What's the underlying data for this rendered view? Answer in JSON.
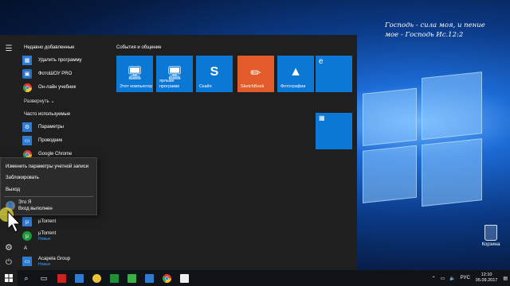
{
  "desktop": {
    "verse_line1": "Господь - сила моя, и пение",
    "verse_line2": "мое - Господь    Ис.12:2",
    "recycle_bin_label": "Корзина"
  },
  "start_menu": {
    "recently_added_header": "Недавно добавленные",
    "recent_apps": [
      {
        "label": "Удалить программу",
        "icon": "uninstall-icon"
      },
      {
        "label": "ФотоШОУ PRO",
        "icon": "photoshow-icon"
      },
      {
        "label": "Он-лайн учебник",
        "icon": "chrome-icon"
      }
    ],
    "expand_label": "Развернуть ⌄",
    "most_used_header": "Часто используемые",
    "most_used_apps": [
      {
        "label": "Параметры",
        "icon": "gear-icon"
      },
      {
        "label": "Проводник",
        "icon": "folder-icon"
      },
      {
        "label": "Google Chrome",
        "icon": "chrome-icon"
      }
    ],
    "bottom_apps": [
      {
        "label": "µTorrent",
        "sub": "",
        "icon": "utorrent-icon"
      },
      {
        "label": "µTorrent",
        "sub": "Новые",
        "icon": "utorrent-icon"
      }
    ],
    "letter_a": "A",
    "acapela": {
      "label": "Acapela Group",
      "sub": "Новые"
    },
    "tiles_header": "События и общение",
    "tiles": [
      {
        "label": "Этот компьютер",
        "icon": "computer-icon"
      },
      {
        "label": "ярлыки программ",
        "icon": "shortcut-icon"
      },
      {
        "label": "Скайп",
        "icon": "skype-icon"
      },
      {
        "label": "SketchBook",
        "icon": "sketchbook-icon"
      },
      {
        "label": "Фотографии",
        "icon": "photos-icon"
      },
      {
        "label": "",
        "icon": "edge-icon"
      },
      {
        "label": "",
        "icon": "calendar-icon"
      }
    ]
  },
  "account_popup": {
    "change_settings": "Изменить параметры учетной записи",
    "lock": "Заблокировать",
    "sign_out": "Выход",
    "user_name": "Это Я",
    "user_status": "Вход выполнен"
  },
  "taskbar": {
    "language": "РУС",
    "time": "12:10",
    "date": "05.09.2017"
  },
  "colors": {
    "accent": "#0b78d6",
    "start_bg": "#1f1f1f",
    "sketchbook": "#e25b2a"
  }
}
